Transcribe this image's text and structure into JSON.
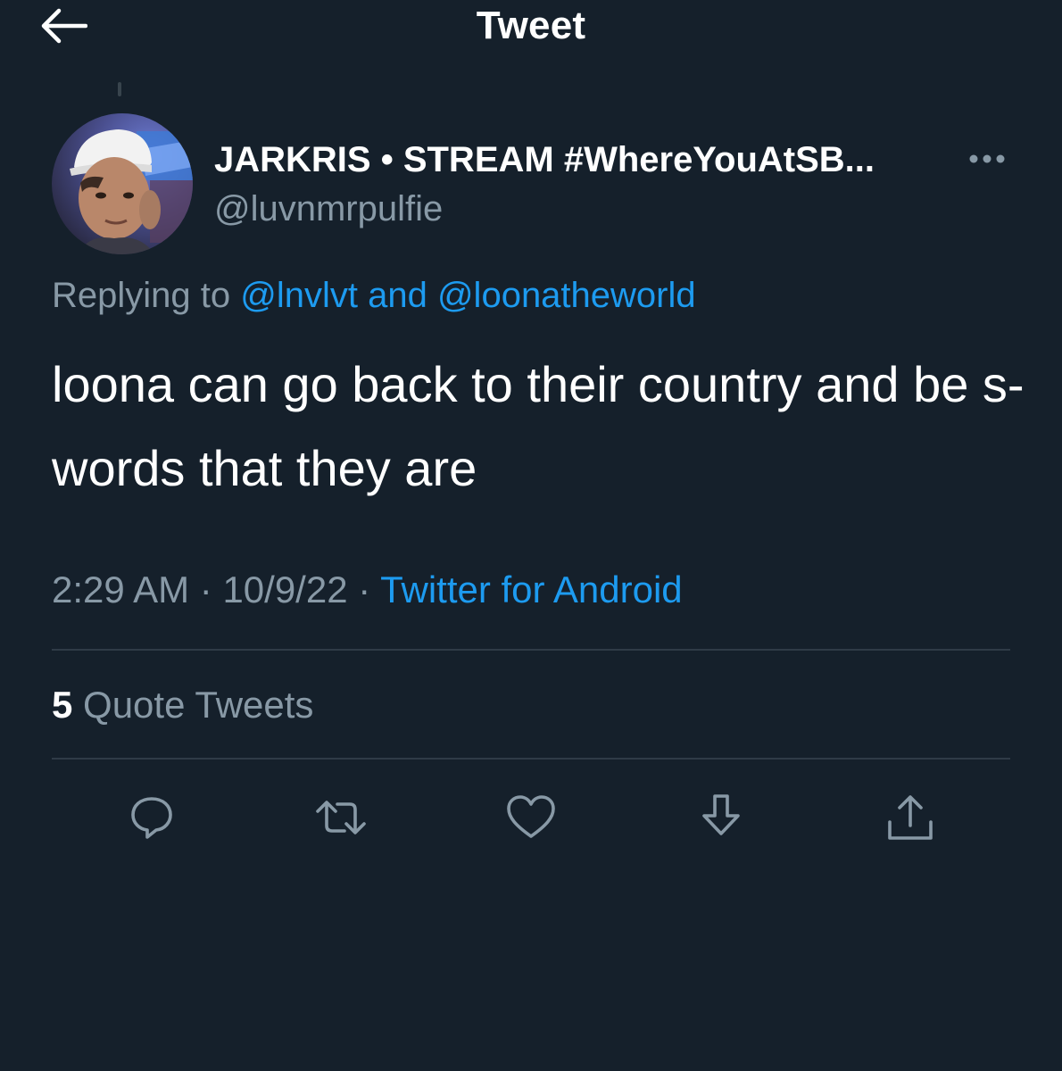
{
  "header": {
    "title": "Tweet",
    "back_icon": "arrow-left-icon"
  },
  "tweet": {
    "author": {
      "display_name": "JARKRIS • STREAM #WhereYouAtSB...",
      "username": "@luvnmrpulfie"
    },
    "replying_to": {
      "prefix": "Replying to ",
      "mention_1": "@lnvlvt",
      "conjunction": " and ",
      "mention_2": "@loonatheworld"
    },
    "text": "loona can go back to their country and be s-words that they are",
    "time": "2:29 AM",
    "separator": " · ",
    "date": "10/9/22",
    "source": "Twitter for Android",
    "quote_count": "5",
    "quote_label": " Quote Tweets"
  },
  "actions": [
    "reply-icon",
    "retweet-icon",
    "like-icon",
    "save-icon",
    "share-icon"
  ],
  "colors": {
    "background": "#15202b",
    "accent": "#1d9bf0",
    "secondary_text": "#8899a6",
    "divider": "#2f3b47"
  }
}
